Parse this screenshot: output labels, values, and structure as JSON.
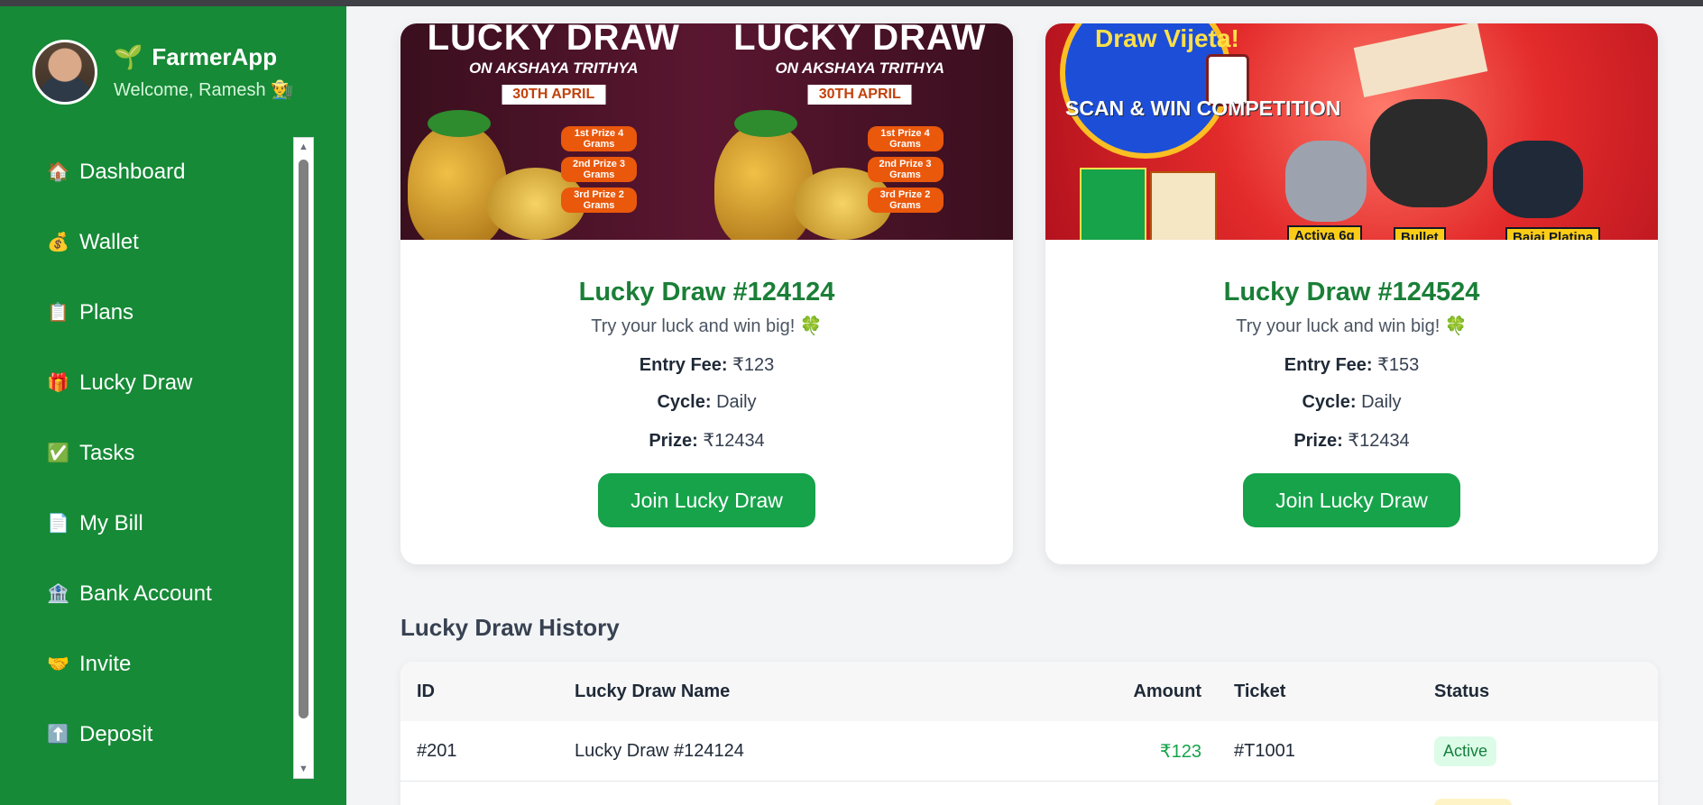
{
  "sidebar": {
    "app_name": "FarmerApp",
    "app_icon": "🌱",
    "welcome": "Welcome, Ramesh 👨‍🌾",
    "items": [
      {
        "icon": "🏠",
        "label": "Dashboard"
      },
      {
        "icon": "💰",
        "label": "Wallet"
      },
      {
        "icon": "📋",
        "label": "Plans"
      },
      {
        "icon": "🎁",
        "label": "Lucky Draw"
      },
      {
        "icon": "✅",
        "label": "Tasks"
      },
      {
        "icon": "📄",
        "label": "My Bill"
      },
      {
        "icon": "🏦",
        "label": "Bank Account"
      },
      {
        "icon": "🤝",
        "label": "Invite"
      },
      {
        "icon": "⬆️",
        "label": "Deposit"
      }
    ]
  },
  "banners": {
    "a": {
      "title": "LUCKY DRAW",
      "subtitle": "ON AKSHAYA TRITHYA",
      "date": "30TH APRIL",
      "prizes": [
        "1st Prize 4 Grams",
        "2nd Prize 3 Grams",
        "3rd Prize 2 Grams"
      ]
    },
    "b": {
      "headline": "Draw Vijeta!",
      "scan": "SCAN & WIN COMPETITION",
      "tags": [
        "Activa 6g",
        "Bullet",
        "Bajaj Platina"
      ]
    }
  },
  "cards": [
    {
      "title": "Lucky Draw #124124",
      "tagline": "Try your luck and win big! 🍀",
      "entry_fee_label": "Entry Fee:",
      "entry_fee": "₹123",
      "cycle_label": "Cycle:",
      "cycle": "Daily",
      "prize_label": "Prize:",
      "prize": "₹12434",
      "button": "Join Lucky Draw"
    },
    {
      "title": "Lucky Draw #124524",
      "tagline": "Try your luck and win big! 🍀",
      "entry_fee_label": "Entry Fee:",
      "entry_fee": "₹153",
      "cycle_label": "Cycle:",
      "cycle": "Daily",
      "prize_label": "Prize:",
      "prize": "₹12434",
      "button": "Join Lucky Draw"
    }
  ],
  "history": {
    "title": "Lucky Draw History",
    "columns": {
      "id": "ID",
      "name": "Lucky Draw Name",
      "amount": "Amount",
      "ticket": "Ticket",
      "status": "Status"
    },
    "rows": [
      {
        "id": "#201",
        "name": "Lucky Draw #124124",
        "amount": "₹123",
        "ticket": "#T1001",
        "status": "Active"
      }
    ]
  },
  "colors": {
    "sidebar": "#168a36",
    "accent": "#16a34a",
    "title": "#1a7f37"
  }
}
